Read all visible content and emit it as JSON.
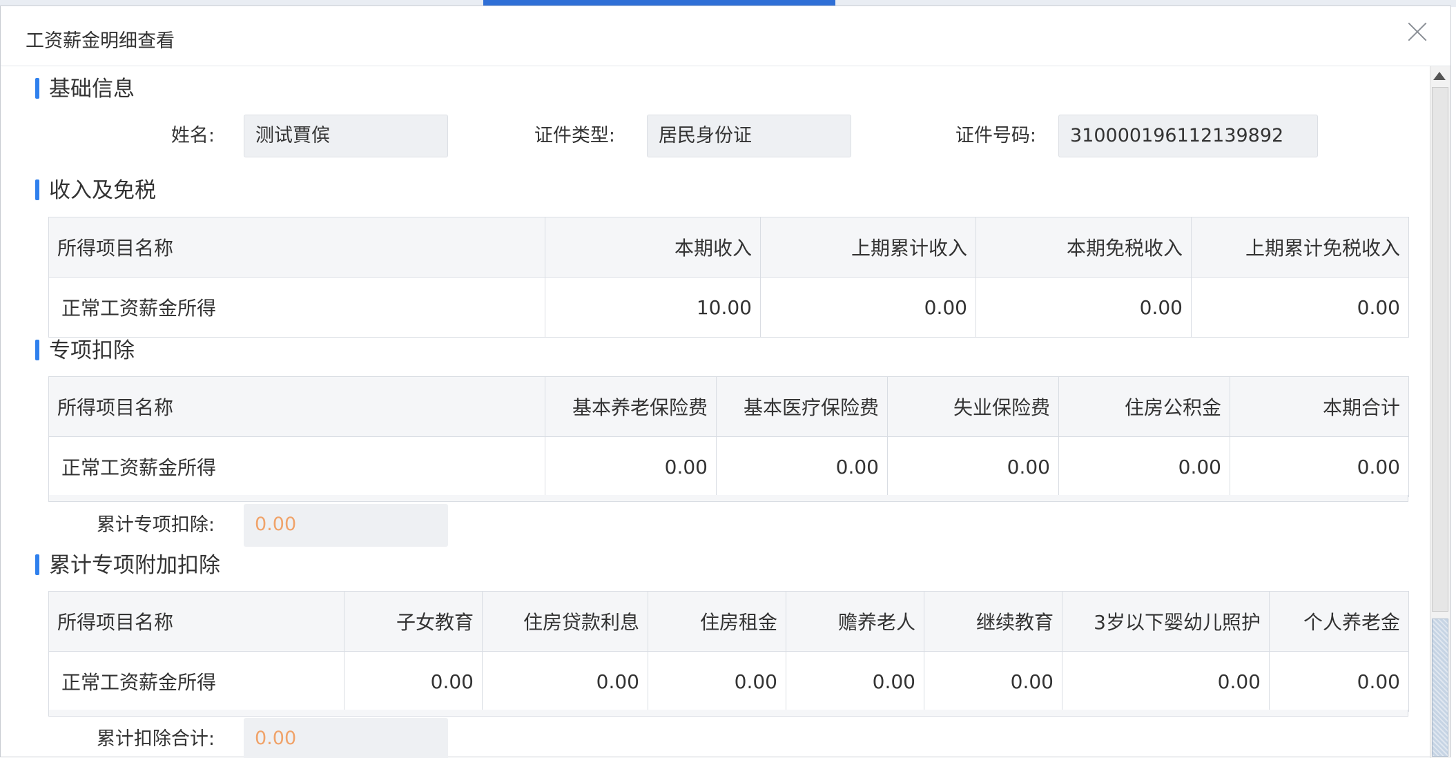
{
  "dialog": {
    "title": "工资薪金明细查看"
  },
  "basic_info": {
    "heading": "基础信息",
    "name_label": "姓名:",
    "name_value": "测试賈傧",
    "id_type_label": "证件类型:",
    "id_type_value": "居民身份证",
    "id_number_label": "证件号码:",
    "id_number_value": "310000196112139892"
  },
  "income": {
    "heading": "收入及免税",
    "columns": [
      "所得项目名称",
      "本期收入",
      "上期累计收入",
      "本期免税收入",
      "上期累计免税收入"
    ],
    "rows": [
      [
        "正常工资薪金所得",
        "10.00",
        "0.00",
        "0.00",
        "0.00"
      ]
    ]
  },
  "special_deduction": {
    "heading": "专项扣除",
    "columns": [
      "所得项目名称",
      "基本养老保险费",
      "基本医疗保险费",
      "失业保险费",
      "住房公积金",
      "本期合计"
    ],
    "rows": [
      [
        "正常工资薪金所得",
        "0.00",
        "0.00",
        "0.00",
        "0.00",
        "0.00"
      ]
    ],
    "total_label": "累计专项扣除:",
    "total_value": "0.00"
  },
  "additional_deduction": {
    "heading": "累计专项附加扣除",
    "columns": [
      "所得项目名称",
      "子女教育",
      "住房贷款利息",
      "住房租金",
      "赡养老人",
      "继续教育",
      "3岁以下婴幼儿照护",
      "个人养老金"
    ],
    "rows": [
      [
        "正常工资薪金所得",
        "0.00",
        "0.00",
        "0.00",
        "0.00",
        "0.00",
        "0.00",
        "0.00"
      ]
    ],
    "total_label": "累计扣除合计:",
    "total_value": "0.00"
  },
  "colors": {
    "accent": "#2f80ed",
    "highlight_value": "#f0a36a",
    "readonly_bg": "#eef0f3",
    "header_bg": "#f5f6f8"
  }
}
